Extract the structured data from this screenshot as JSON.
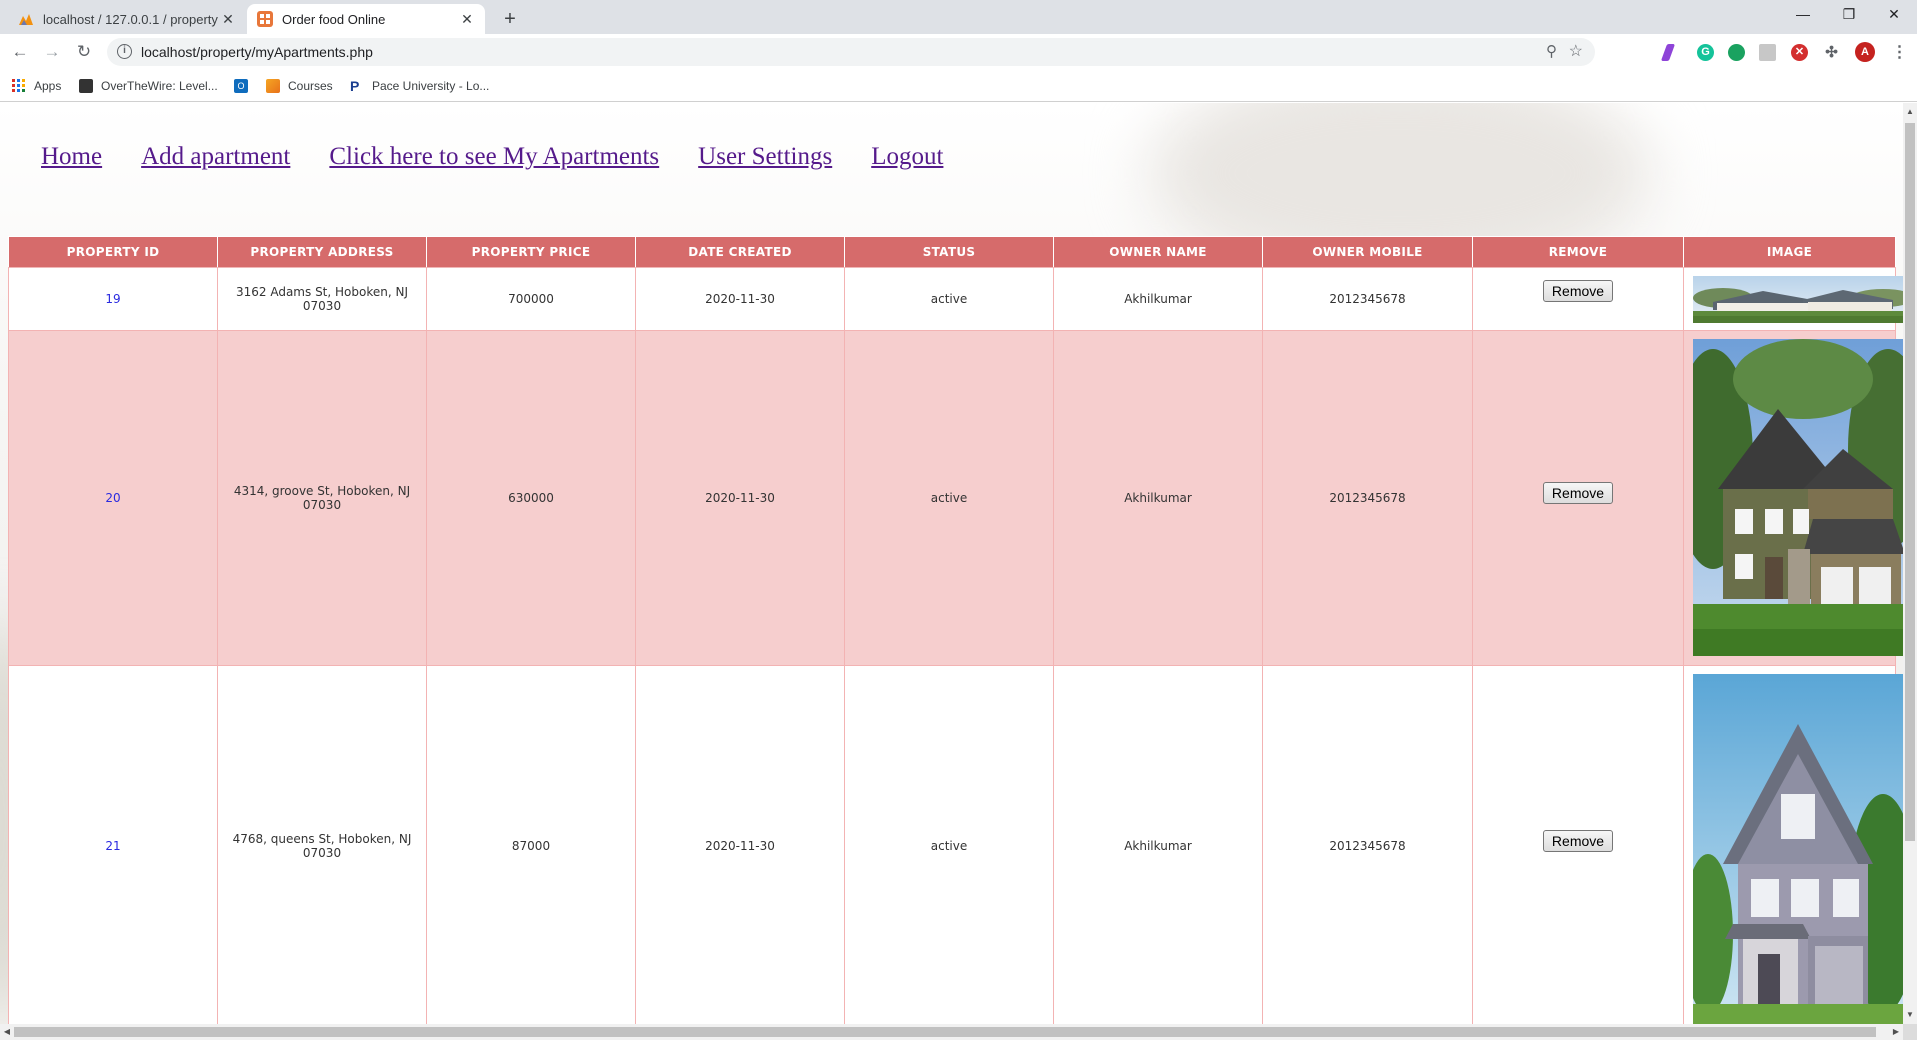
{
  "browser": {
    "tabs": [
      {
        "title": "localhost / 127.0.0.1 / property /",
        "active": false,
        "favicon": "phpmyadmin-icon"
      },
      {
        "title": "Order food Online",
        "active": true,
        "favicon": "site-icon"
      }
    ],
    "url": "localhost/property/myApartments.php",
    "bookmarks": [
      {
        "label": "Apps",
        "icon": "apps-grid-icon"
      },
      {
        "label": "OverTheWire: Level...",
        "icon": "overthewire-icon"
      },
      {
        "label": "",
        "icon": "outlook-icon"
      },
      {
        "label": "Courses",
        "icon": "courses-icon"
      },
      {
        "label": "Pace University - Lo...",
        "icon": "pace-icon"
      }
    ],
    "profile_initial": "A"
  },
  "nav": {
    "home": "Home",
    "add": "Add apartment",
    "my": "Click here to see My Apartments",
    "settings": "User Settings",
    "logout": "Logout"
  },
  "table": {
    "headers": [
      "PROPERTY ID",
      "PROPERTY ADDRESS",
      "PROPERTY PRICE",
      "DATE CREATED",
      "STATUS",
      "OWNER NAME",
      "OWNER MOBILE",
      "REMOVE",
      "IMAGE"
    ],
    "remove_label": "Remove",
    "rows": [
      {
        "id": "19",
        "address": "3162 Adams St, Hoboken, NJ 07030",
        "price": "700000",
        "date": "2020-11-30",
        "status": "active",
        "owner": "Akhilkumar",
        "mobile": "2012345678",
        "image": "ranch-house-photo"
      },
      {
        "id": "20",
        "address": "4314, groove St, Hoboken, NJ 07030",
        "price": "630000",
        "date": "2020-11-30",
        "status": "active",
        "owner": "Akhilkumar",
        "mobile": "2012345678",
        "image": "two-story-house-photo"
      },
      {
        "id": "21",
        "address": "4768, queens St, Hoboken, NJ 07030",
        "price": "87000",
        "date": "2020-11-30",
        "status": "active",
        "owner": "Akhilkumar",
        "mobile": "2012345678",
        "image": "grey-house-photo"
      }
    ]
  },
  "colors": {
    "header_bg": "#d66b6b",
    "even_row_bg": "#f6cece",
    "link": "#551a8b",
    "id_text": "#2a2ae0"
  }
}
